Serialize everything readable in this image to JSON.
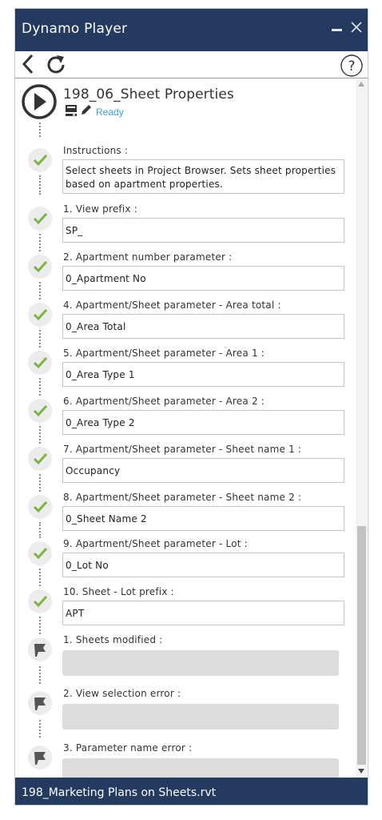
{
  "window": {
    "title": "Dynamo Player"
  },
  "script": {
    "title": "198_06_Sheet Properties",
    "status": "Ready"
  },
  "inputs": [
    {
      "label": "Instructions :",
      "value": "Select sheets in Project Browser. Sets sheet properties based on apartment properties."
    },
    {
      "label": "1. View prefix :",
      "value": "SP_"
    },
    {
      "label": "2. Apartment number parameter :",
      "value": "0_Apartment No"
    },
    {
      "label": "4. Apartment/Sheet parameter - Area total :",
      "value": "0_Area Total"
    },
    {
      "label": "5. Apartment/Sheet parameter - Area 1 :",
      "value": "0_Area Type 1"
    },
    {
      "label": "6. Apartment/Sheet parameter - Area 2 :",
      "value": "0_Area Type 2"
    },
    {
      "label": "7. Apartment/Sheet parameter - Sheet name 1 :",
      "value": "Occupancy"
    },
    {
      "label": "8. Apartment/Sheet parameter - Sheet name 2 :",
      "value": "0_Sheet Name 2"
    },
    {
      "label": "9. Apartment/Sheet parameter - Lot :",
      "value": "0_Lot No"
    },
    {
      "label": "10. Sheet - Lot prefix :",
      "value": "APT"
    }
  ],
  "outputs": [
    {
      "label": "1. Sheets modified :",
      "value": ""
    },
    {
      "label": "2. View selection error :",
      "value": ""
    },
    {
      "label": "3. Parameter name error :",
      "value": ""
    }
  ],
  "footer": {
    "file": "198_Marketing Plans on Sheets.rvt"
  },
  "colors": {
    "header": "#243a5e",
    "check": "#7cb342",
    "status": "#3aa0d8",
    "output_bg": "#dcdcdc"
  },
  "icons": {
    "back": "chevron-left-icon",
    "refresh": "refresh-icon",
    "help": "help-icon",
    "play": "play-icon",
    "check": "check-icon",
    "flag": "flag-icon"
  }
}
